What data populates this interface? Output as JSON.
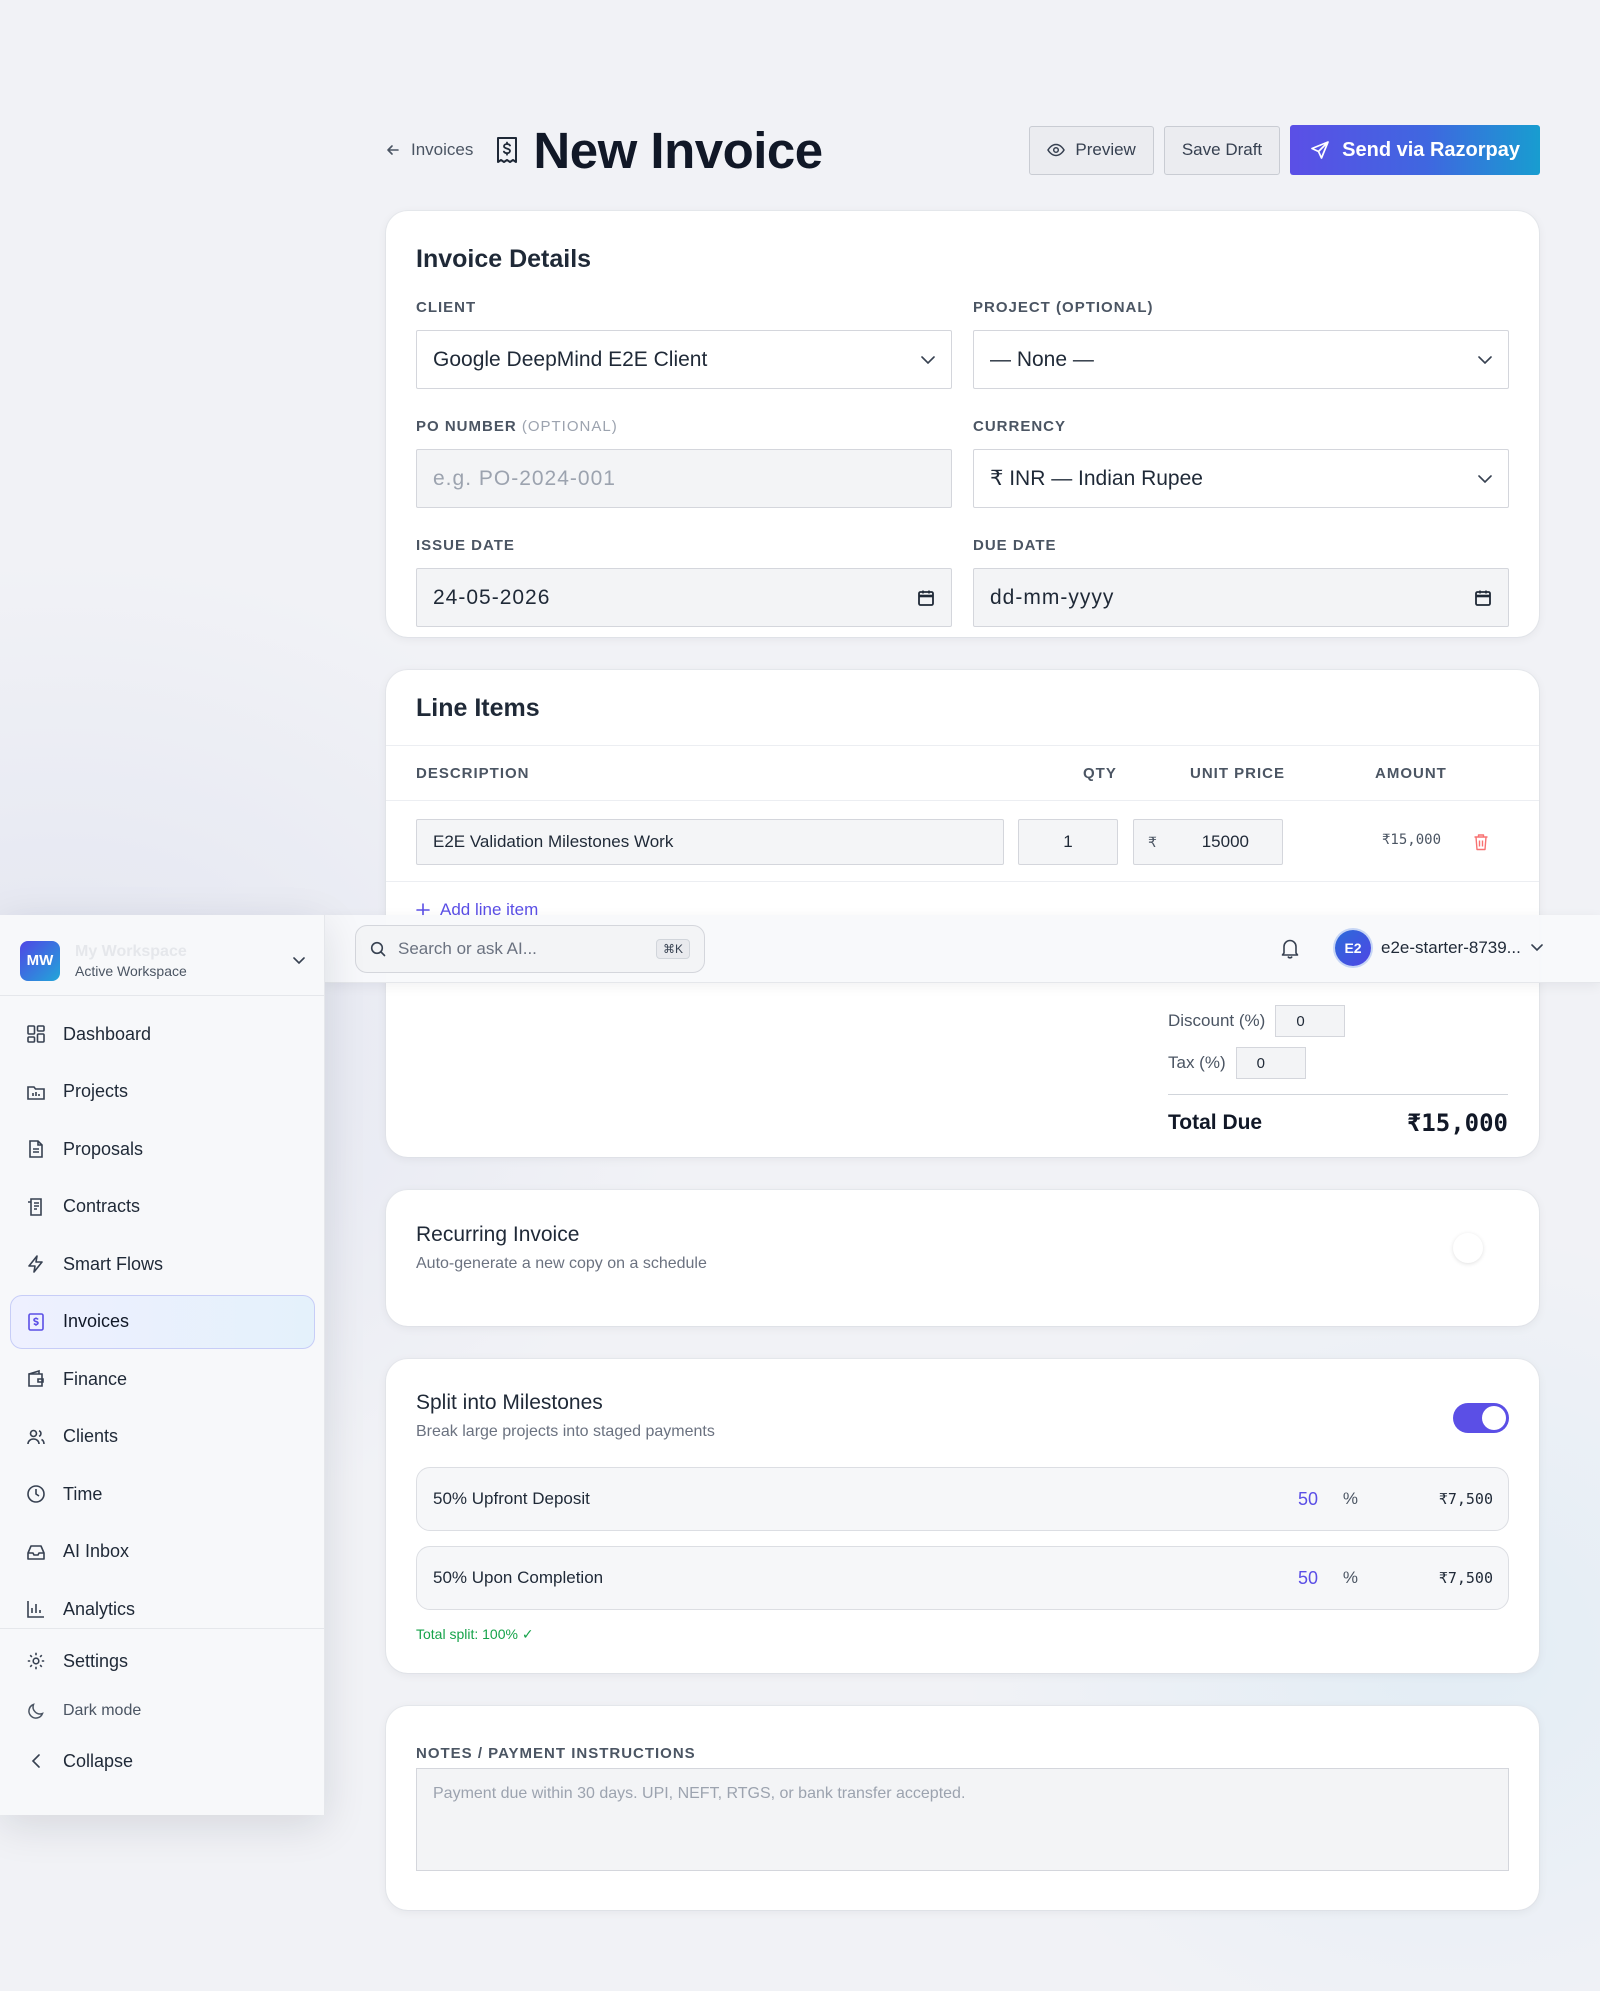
{
  "header": {
    "back_label": "Invoices",
    "title": "New Invoice",
    "preview_label": "Preview",
    "save_draft_label": "Save Draft",
    "send_label": "Send via Razorpay"
  },
  "details": {
    "title": "Invoice Details",
    "client_label": "CLIENT",
    "client_value": "Google DeepMind E2E Client",
    "project_label": "PROJECT",
    "project_optional": "(OPTIONAL)",
    "project_value": "— None —",
    "po_label": "PO NUMBER",
    "po_optional": "(OPTIONAL)",
    "po_placeholder": "e.g. PO-2024-001",
    "currency_label": "CURRENCY",
    "currency_value": "₹ INR — Indian Rupee",
    "issue_label": "ISSUE DATE",
    "issue_value": "24-05-2026",
    "due_label": "DUE DATE",
    "due_placeholder": "dd-mm-yyyy"
  },
  "line_items": {
    "title": "Line Items",
    "col_description": "DESCRIPTION",
    "col_qty": "QTY",
    "col_unit_price": "UNIT PRICE",
    "col_amount": "AMOUNT",
    "rows": [
      {
        "description": "E2E Validation Milestones Work",
        "qty": "1",
        "currency_symbol": "₹",
        "unit_price": "15000",
        "amount": "₹15,000"
      }
    ],
    "add_label": "Add line item",
    "discount_label": "Discount (%)",
    "discount_value": "0",
    "tax_label": "Tax (%)",
    "tax_value": "0",
    "total_label": "Total Due",
    "total_value": "₹15,000"
  },
  "recurring": {
    "title": "Recurring Invoice",
    "subtitle": "Auto-generate a new copy on a schedule",
    "enabled": false
  },
  "milestones": {
    "title": "Split into Milestones",
    "subtitle": "Break large projects into staged payments",
    "enabled": true,
    "pct_symbol": "%",
    "items": [
      {
        "name": "50% Upfront Deposit",
        "percent": "50",
        "amount": "₹7,500"
      },
      {
        "name": "50% Upon Completion",
        "percent": "50",
        "amount": "₹7,500"
      }
    ],
    "total_split": "Total split: 100% ✓"
  },
  "notes": {
    "label": "NOTES / PAYMENT INSTRUCTIONS",
    "placeholder": "Payment due within 30 days. UPI, NEFT, RTGS, or bank transfer accepted."
  },
  "topbar": {
    "search_placeholder": "Search or ask AI...",
    "shortcut": "⌘K",
    "user_initials": "E2",
    "user_name": "e2e-starter-8739..."
  },
  "sidebar": {
    "workspace_initials": "MW",
    "workspace_name": "My Workspace",
    "workspace_sub": "Active Workspace",
    "items": [
      {
        "label": "Dashboard",
        "icon": "dashboard-icon"
      },
      {
        "label": "Projects",
        "icon": "projects-icon"
      },
      {
        "label": "Proposals",
        "icon": "proposals-icon"
      },
      {
        "label": "Contracts",
        "icon": "contracts-icon"
      },
      {
        "label": "Smart Flows",
        "icon": "lightning-icon"
      },
      {
        "label": "Invoices",
        "icon": "invoice-icon",
        "active": true
      },
      {
        "label": "Finance",
        "icon": "wallet-icon"
      },
      {
        "label": "Clients",
        "icon": "users-icon"
      },
      {
        "label": "Time",
        "icon": "clock-icon"
      },
      {
        "label": "AI Inbox",
        "icon": "inbox-icon"
      },
      {
        "label": "Analytics",
        "icon": "chart-icon"
      }
    ],
    "settings_label": "Settings",
    "dark_mode_label": "Dark mode",
    "collapse_label": "Collapse"
  },
  "colors": {
    "accent": "#5b4fe6",
    "success": "#16a34a",
    "danger": "#f87171"
  }
}
